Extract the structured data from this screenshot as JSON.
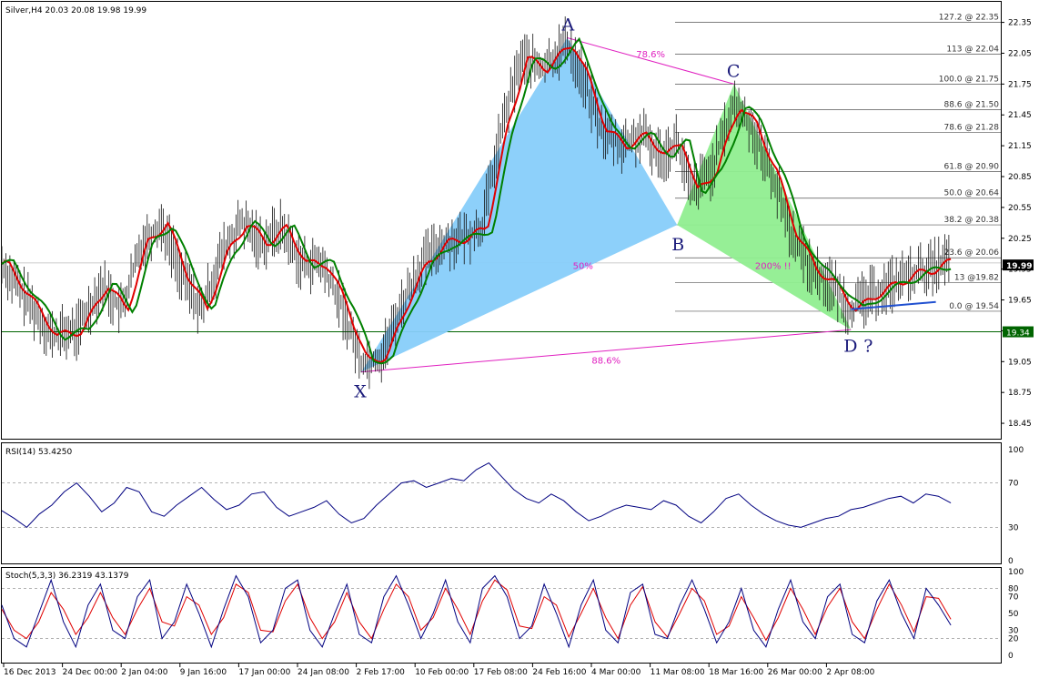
{
  "chart_data": {
    "type": "line",
    "main": {
      "title": "Silver,H4  20.03 20.08 19.98 19.99",
      "ylim": [
        18.3,
        22.55
      ],
      "yticks": [
        "22.35",
        "22.05",
        "21.75",
        "21.45",
        "21.15",
        "20.85",
        "20.55",
        "20.25",
        "19.95",
        "19.65",
        "19.35",
        "19.05",
        "18.75",
        "18.45"
      ],
      "current_price": "19.99",
      "support_level": "19.34",
      "pattern_points": {
        "X": {
          "t": 0.36,
          "v": 18.95
        },
        "A": {
          "t": 0.566,
          "v": 22.2
        },
        "B": {
          "t": 0.676,
          "v": 20.38
        },
        "C": {
          "t": 0.733,
          "v": 21.75
        },
        "D": {
          "t": 0.85,
          "v": 19.36
        }
      },
      "pattern_labels": [
        "X",
        "A",
        "B",
        "C",
        "D",
        "?"
      ],
      "ratios": [
        "78.6%",
        "50%",
        "200% !!",
        "88.6%"
      ],
      "fib_levels": [
        {
          "label": "127.2 @ 22.35",
          "v": 22.35
        },
        {
          "label": "113 @ 22.04",
          "v": 22.04
        },
        {
          "label": "100.0 @ 21.75",
          "v": 21.75
        },
        {
          "label": "88.6 @ 21.50",
          "v": 21.5
        },
        {
          "label": "78.6 @ 21.28",
          "v": 21.28
        },
        {
          "label": "61.8 @ 20.90",
          "v": 20.9
        },
        {
          "label": "50.0 @ 20.64",
          "v": 20.64
        },
        {
          "label": "38.2 @ 20.38",
          "v": 20.38
        },
        {
          "label": "23.6 @ 20.06",
          "v": 20.06
        },
        {
          "label": "13 @19.82",
          "v": 19.82
        },
        {
          "label": "0.0 @ 19.54",
          "v": 19.54
        }
      ],
      "price_path": [
        [
          0.0,
          20.0
        ],
        [
          0.025,
          19.65
        ],
        [
          0.05,
          19.3
        ],
        [
          0.075,
          19.35
        ],
        [
          0.1,
          19.8
        ],
        [
          0.12,
          19.55
        ],
        [
          0.14,
          20.2
        ],
        [
          0.16,
          20.4
        ],
        [
          0.18,
          19.9
        ],
        [
          0.2,
          19.55
        ],
        [
          0.22,
          20.1
        ],
        [
          0.24,
          20.4
        ],
        [
          0.26,
          20.2
        ],
        [
          0.28,
          20.35
        ],
        [
          0.3,
          20.0
        ],
        [
          0.32,
          20.0
        ],
        [
          0.34,
          19.6
        ],
        [
          0.36,
          19.05
        ],
        [
          0.38,
          19.1
        ],
        [
          0.4,
          19.6
        ],
        [
          0.42,
          20.0
        ],
        [
          0.44,
          20.2
        ],
        [
          0.46,
          20.25
        ],
        [
          0.48,
          20.35
        ],
        [
          0.5,
          21.3
        ],
        [
          0.52,
          22.0
        ],
        [
          0.54,
          21.9
        ],
        [
          0.566,
          22.15
        ],
        [
          0.58,
          21.85
        ],
        [
          0.6,
          21.3
        ],
        [
          0.62,
          21.15
        ],
        [
          0.64,
          21.25
        ],
        [
          0.66,
          21.05
        ],
        [
          0.676,
          21.2
        ],
        [
          0.69,
          20.7
        ],
        [
          0.71,
          20.9
        ],
        [
          0.733,
          21.55
        ],
        [
          0.75,
          21.35
        ],
        [
          0.77,
          20.9
        ],
        [
          0.79,
          20.3
        ],
        [
          0.81,
          19.95
        ],
        [
          0.83,
          19.8
        ],
        [
          0.85,
          19.55
        ],
        [
          0.87,
          19.7
        ],
        [
          0.89,
          19.8
        ],
        [
          0.91,
          19.9
        ],
        [
          0.93,
          19.95
        ],
        [
          0.95,
          20.05
        ]
      ],
      "trendline": [
        [
          0.85,
          19.56
        ],
        [
          0.935,
          19.63
        ]
      ]
    },
    "rsi": {
      "title": "RSI(14) 53.4250",
      "ylim": [
        0,
        100
      ],
      "yticks": [
        "100",
        "70",
        "30",
        "0"
      ],
      "levels": [
        70,
        30
      ],
      "values": [
        45,
        38,
        30,
        42,
        50,
        62,
        70,
        58,
        44,
        52,
        66,
        62,
        44,
        40,
        50,
        58,
        66,
        55,
        46,
        50,
        60,
        62,
        48,
        40,
        44,
        48,
        54,
        42,
        34,
        38,
        50,
        60,
        70,
        72,
        66,
        70,
        74,
        72,
        82,
        88,
        76,
        64,
        56,
        52,
        60,
        54,
        44,
        36,
        40,
        46,
        50,
        48,
        46,
        54,
        50,
        40,
        34,
        44,
        56,
        60,
        50,
        42,
        36,
        32,
        30,
        34,
        38,
        40,
        46,
        48,
        52,
        56,
        58,
        52,
        60,
        58,
        52
      ]
    },
    "stoch": {
      "title": "Stoch(5,3,3) 36.2319 43.1379",
      "ylim": [
        0,
        100
      ],
      "yticks": [
        "100",
        "80",
        "70",
        "50",
        "30",
        "20",
        "0"
      ],
      "levels": [
        80,
        20
      ],
      "main_values": [
        60,
        20,
        10,
        50,
        90,
        40,
        10,
        60,
        85,
        30,
        20,
        70,
        90,
        20,
        40,
        85,
        50,
        10,
        55,
        95,
        70,
        15,
        30,
        80,
        90,
        30,
        10,
        50,
        85,
        25,
        15,
        70,
        95,
        60,
        20,
        50,
        90,
        40,
        15,
        80,
        95,
        70,
        20,
        35,
        85,
        50,
        10,
        60,
        90,
        30,
        15,
        75,
        85,
        25,
        20,
        60,
        90,
        55,
        15,
        40,
        80,
        30,
        10,
        55,
        90,
        40,
        20,
        70,
        85,
        25,
        15,
        65,
        90,
        50,
        20,
        80,
        60,
        36
      ],
      "signal_values": [
        55,
        30,
        20,
        40,
        75,
        55,
        25,
        45,
        75,
        45,
        25,
        55,
        80,
        40,
        35,
        70,
        60,
        25,
        45,
        85,
        75,
        30,
        28,
        65,
        85,
        45,
        20,
        40,
        75,
        40,
        20,
        55,
        85,
        70,
        30,
        45,
        80,
        55,
        25,
        65,
        90,
        78,
        35,
        32,
        70,
        60,
        22,
        50,
        80,
        45,
        20,
        60,
        82,
        40,
        22,
        50,
        80,
        65,
        25,
        35,
        70,
        45,
        18,
        45,
        80,
        55,
        25,
        58,
        80,
        40,
        20,
        55,
        85,
        60,
        28,
        70,
        68,
        43
      ]
    },
    "x_labels": [
      "16 Dec 2013",
      "24 Dec 00:00",
      "2 Jan 04:00",
      "9 Jan 16:00",
      "17 Jan 00:00",
      "24 Jan 08:00",
      "2 Feb 17:00",
      "10 Feb 00:00",
      "17 Feb 08:00",
      "24 Feb 16:00",
      "4 Mar 00:00",
      "11 Mar 08:00",
      "18 Mar 16:00",
      "26 Mar 00:00",
      "2 Apr 08:00"
    ],
    "colors": {
      "blue_harmonic": "#87cefa",
      "green_harmonic": "#90ee90",
      "red_ma": "#e00000",
      "green_ma": "#008000",
      "yellow_ma": "#e8e000",
      "pattern_line": "#e020c0",
      "rsi_line": "#000080",
      "stoch_main": "#000080",
      "stoch_signal": "#e00000"
    }
  }
}
